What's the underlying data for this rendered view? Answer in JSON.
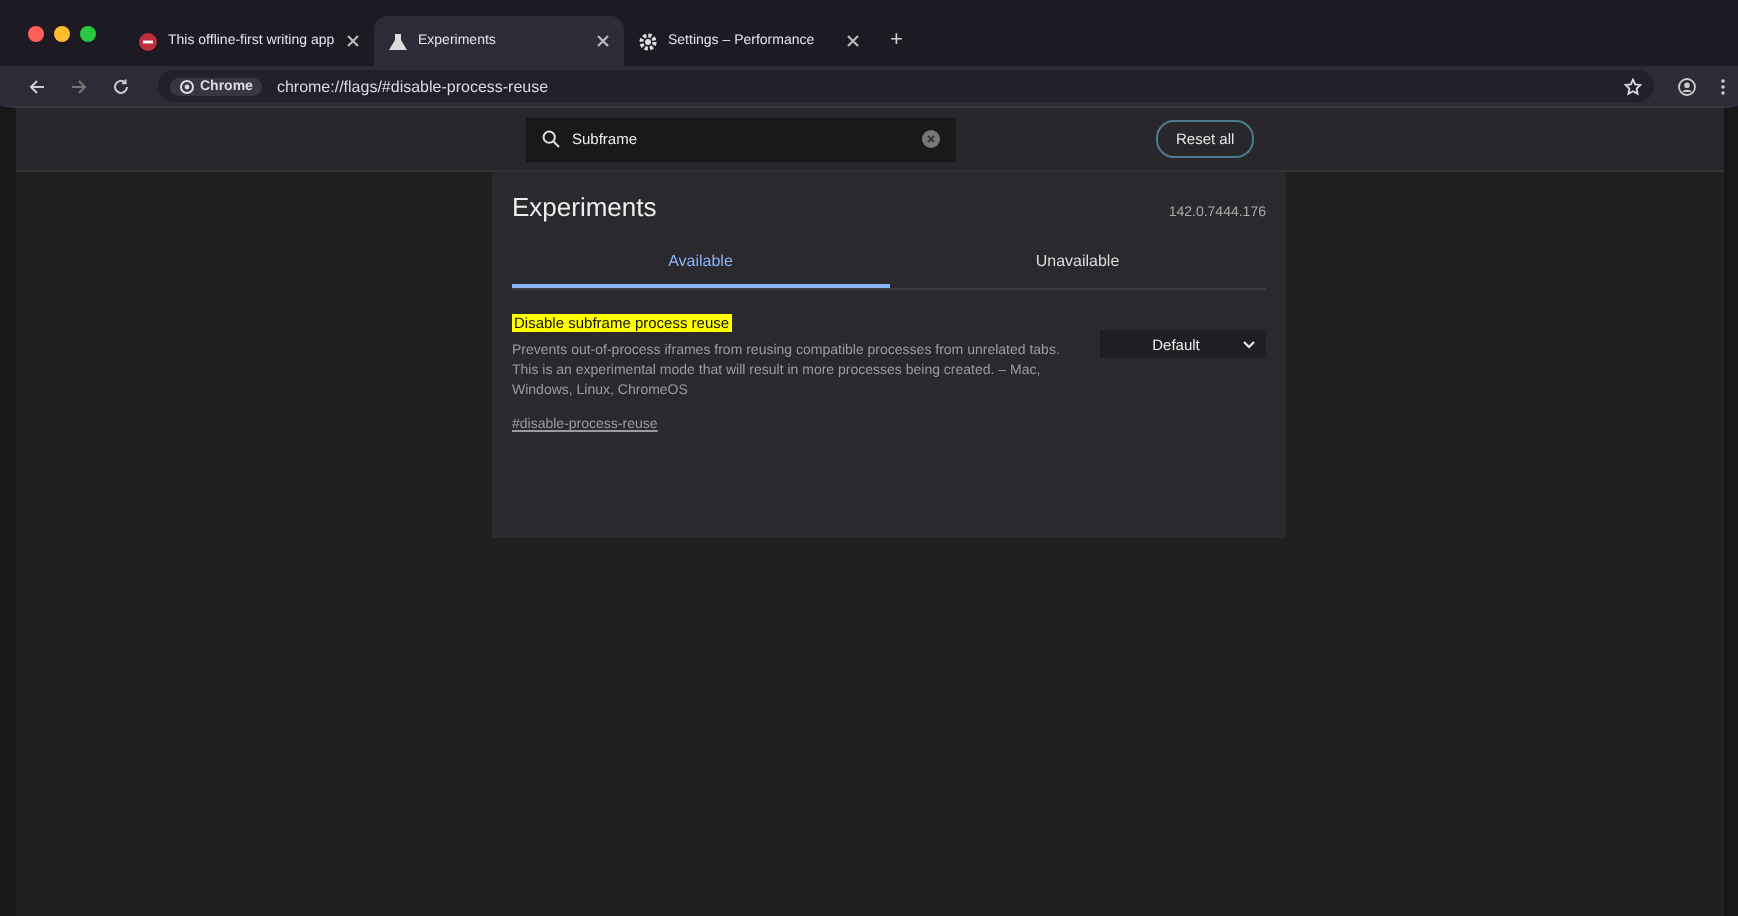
{
  "tabs": [
    {
      "title": "This offline-first writing app",
      "selected": false,
      "kind": "site"
    },
    {
      "title": "Experiments",
      "selected": true,
      "kind": "flask"
    },
    {
      "title": "Settings – Performance",
      "selected": false,
      "kind": "gear"
    }
  ],
  "new_tab": "+",
  "toolbar": {
    "chip": "Chrome",
    "url": "chrome://flags/#disable-process-reuse"
  },
  "search": {
    "value": "Subframe"
  },
  "reset_button": "Reset all",
  "page": {
    "title": "Experiments",
    "version": "142.0.7444.176"
  },
  "page_tabs": [
    {
      "label": "Available",
      "selected": true
    },
    {
      "label": "Unavailable",
      "selected": false
    }
  ],
  "flags": [
    {
      "name": "Disable subframe process reuse",
      "highlighted": true,
      "description": "Prevents out-of-process iframes from reusing compatible processes from unrelated tabs. This is an experimental mode that will result in more processes being created. – Mac, Windows, Linux, ChromeOS",
      "link": "#disable-process-reuse",
      "value": "Default"
    }
  ]
}
